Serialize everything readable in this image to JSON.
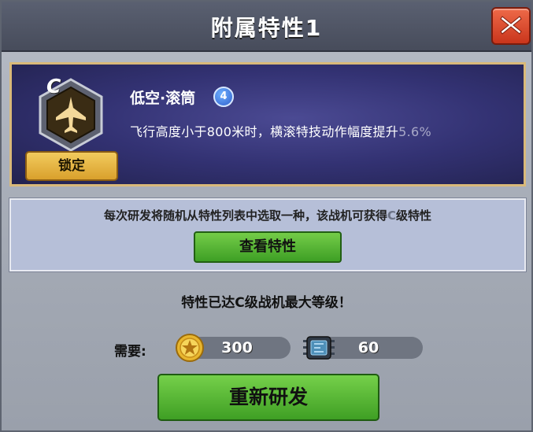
{
  "dialog": {
    "title": "附属特性1",
    "close_label": "X"
  },
  "trait": {
    "grade": "C",
    "icon": "jet-icon",
    "lock_label": "锁定",
    "name": "低空·滚筒",
    "level": "4",
    "desc_main": "飞行高度小于800米时，横滚特技动作幅度提升",
    "desc_pct": "5.6%"
  },
  "info": {
    "text_before": "每次研发将随机从特性列表中选取一种，该战机可获得",
    "text_grade": "C",
    "text_after": "级特性",
    "view_label": "查看特性"
  },
  "max_message": "特性已达C级战机最大等级！",
  "cost": {
    "label": "需要:",
    "coin_amount": "300",
    "coin_icon": "gold-coin-star-icon",
    "chip_amount": "60",
    "chip_icon": "microchip-icon"
  },
  "redevelop_label": "重新研发",
  "colors": {
    "title_bar": "#4e5365",
    "trait_panel": "#333273",
    "gold_button": "#e3b247",
    "green_button": "#56b634",
    "close_button": "#d9462a"
  }
}
